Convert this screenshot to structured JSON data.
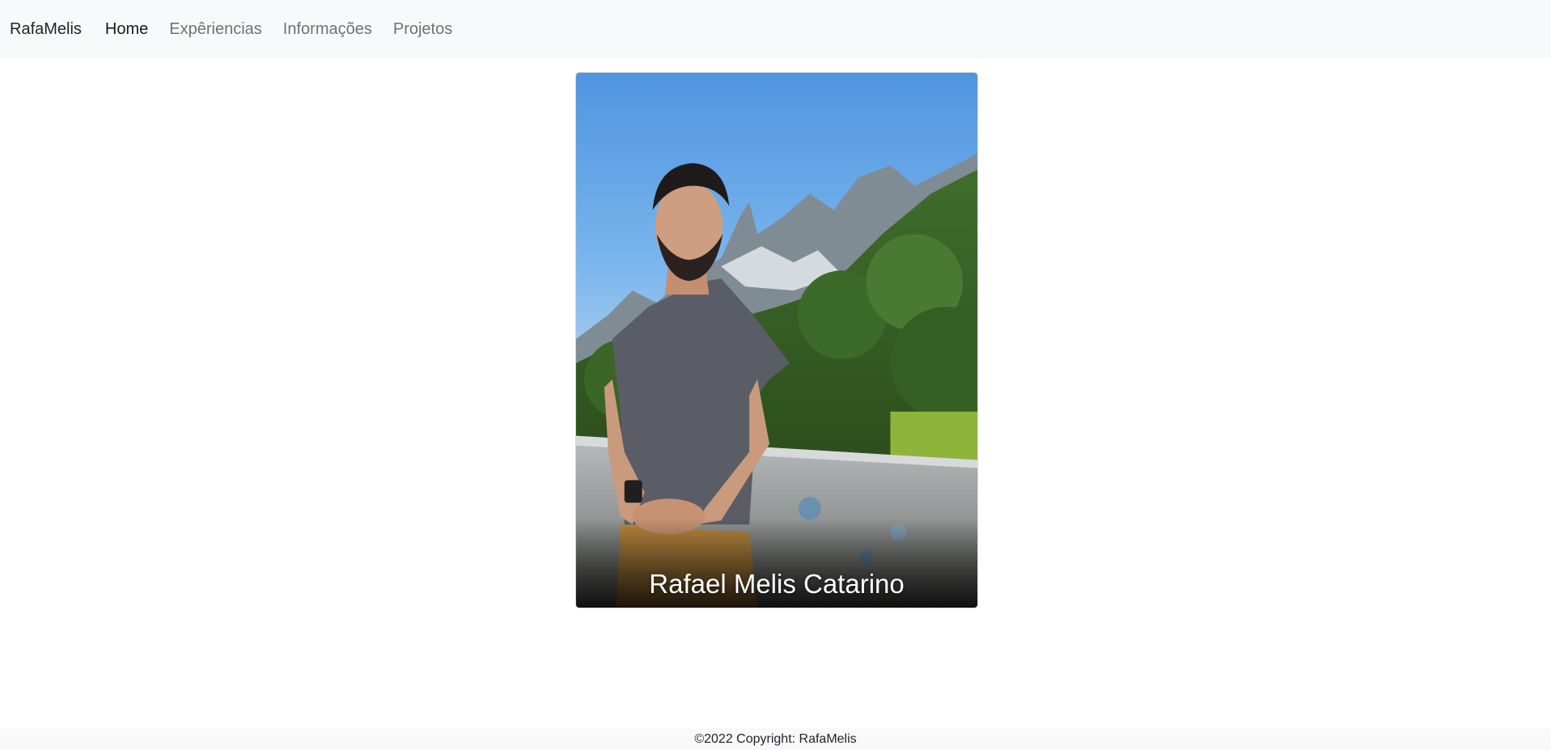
{
  "navbar": {
    "brand": "RafaMelis",
    "links": [
      {
        "label": "Home",
        "active": true
      },
      {
        "label": "Expêriencias",
        "active": false
      },
      {
        "label": "Informações",
        "active": false
      },
      {
        "label": "Projetos",
        "active": false
      }
    ]
  },
  "hero": {
    "image_alt": "Photo of Rafael Melis Catarino in front of mountains",
    "caption": "Rafael Melis Catarino"
  },
  "footer": {
    "text": "©2022 Copyright: RafaMelis"
  },
  "colors": {
    "navbar_bg": "#f8f9fa",
    "footer_bg": "#f8f9fa",
    "link_muted": "#8c8c8c",
    "link_active": "#1a1a1a"
  }
}
